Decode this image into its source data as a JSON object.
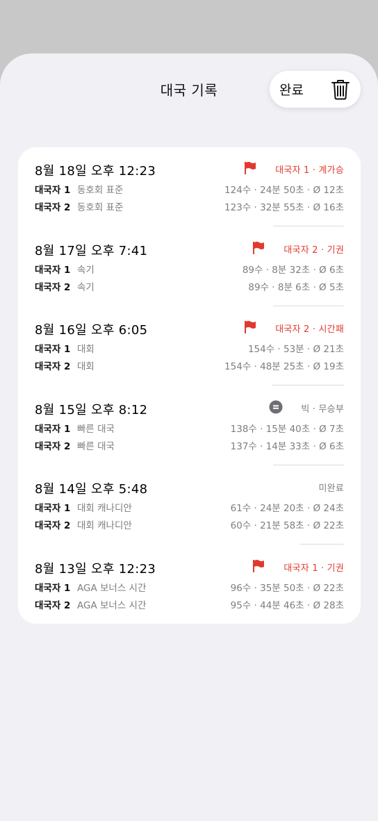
{
  "header": {
    "title": "대국 기록",
    "done_label": "완료"
  },
  "colors": {
    "accent_red": "#e2392f",
    "muted": "#7d7d82"
  },
  "games": [
    {
      "date": "8월 18일 오후 12:23",
      "result_icon": "flag-icon",
      "result": "대국자 1 · 계가승",
      "result_color": "#e2392f",
      "players": [
        {
          "name": "대국자 1",
          "desc": "동호회 표준",
          "stats": "124수 · 24분 50초 · Ø 12초"
        },
        {
          "name": "대국자 2",
          "desc": "동호회 표준",
          "stats": "123수 · 32분 55초 · Ø 16초"
        }
      ]
    },
    {
      "date": "8월 17일 오후 7:41",
      "result_icon": "flag-icon",
      "result": "대국자 2 · 기권",
      "result_color": "#e2392f",
      "players": [
        {
          "name": "대국자 1",
          "desc": "속기",
          "stats": "89수 · 8분 32초 · Ø 6초"
        },
        {
          "name": "대국자 2",
          "desc": "속기",
          "stats": "89수 · 8분 6초 · Ø 5초"
        }
      ]
    },
    {
      "date": "8월 16일 오후 6:05",
      "result_icon": "flag-icon",
      "result": "대국자 2 · 시간패",
      "result_color": "#e2392f",
      "players": [
        {
          "name": "대국자 1",
          "desc": "대회",
          "stats": "154수 · 53분 · Ø 21초"
        },
        {
          "name": "대국자 2",
          "desc": "대회",
          "stats": "154수 · 48분 25초 · Ø 19초"
        }
      ]
    },
    {
      "date": "8월 15일 오후 8:12",
      "result_icon": "equals-circle-icon",
      "result": "빅 · 무승부",
      "result_color": "#7d7d82",
      "players": [
        {
          "name": "대국자 1",
          "desc": "빠른 대국",
          "stats": "138수 · 15분 40초 · Ø 7초"
        },
        {
          "name": "대국자 2",
          "desc": "빠른 대국",
          "stats": "137수 · 14분 33초 · Ø 6초"
        }
      ]
    },
    {
      "date": "8월 14일 오후 5:48",
      "result_icon": "",
      "result": "미완료",
      "result_color": "#7d7d82",
      "players": [
        {
          "name": "대국자 1",
          "desc": "대회 캐나디안",
          "stats": "61수 · 24분 20초 · Ø 24초"
        },
        {
          "name": "대국자 2",
          "desc": "대회 캐나디안",
          "stats": "60수 · 21분 58초 · Ø 22초"
        }
      ]
    },
    {
      "date": "8월 13일 오후 12:23",
      "result_icon": "flag-icon",
      "result": "대국자 1 · 기권",
      "result_color": "#e2392f",
      "players": [
        {
          "name": "대국자 1",
          "desc": "AGA 보너스 시간",
          "stats": "96수 · 35분 50초 · Ø 22초"
        },
        {
          "name": "대국자 2",
          "desc": "AGA 보너스 시간",
          "stats": "95수 · 44분 46초 · Ø 28초"
        }
      ]
    }
  ]
}
